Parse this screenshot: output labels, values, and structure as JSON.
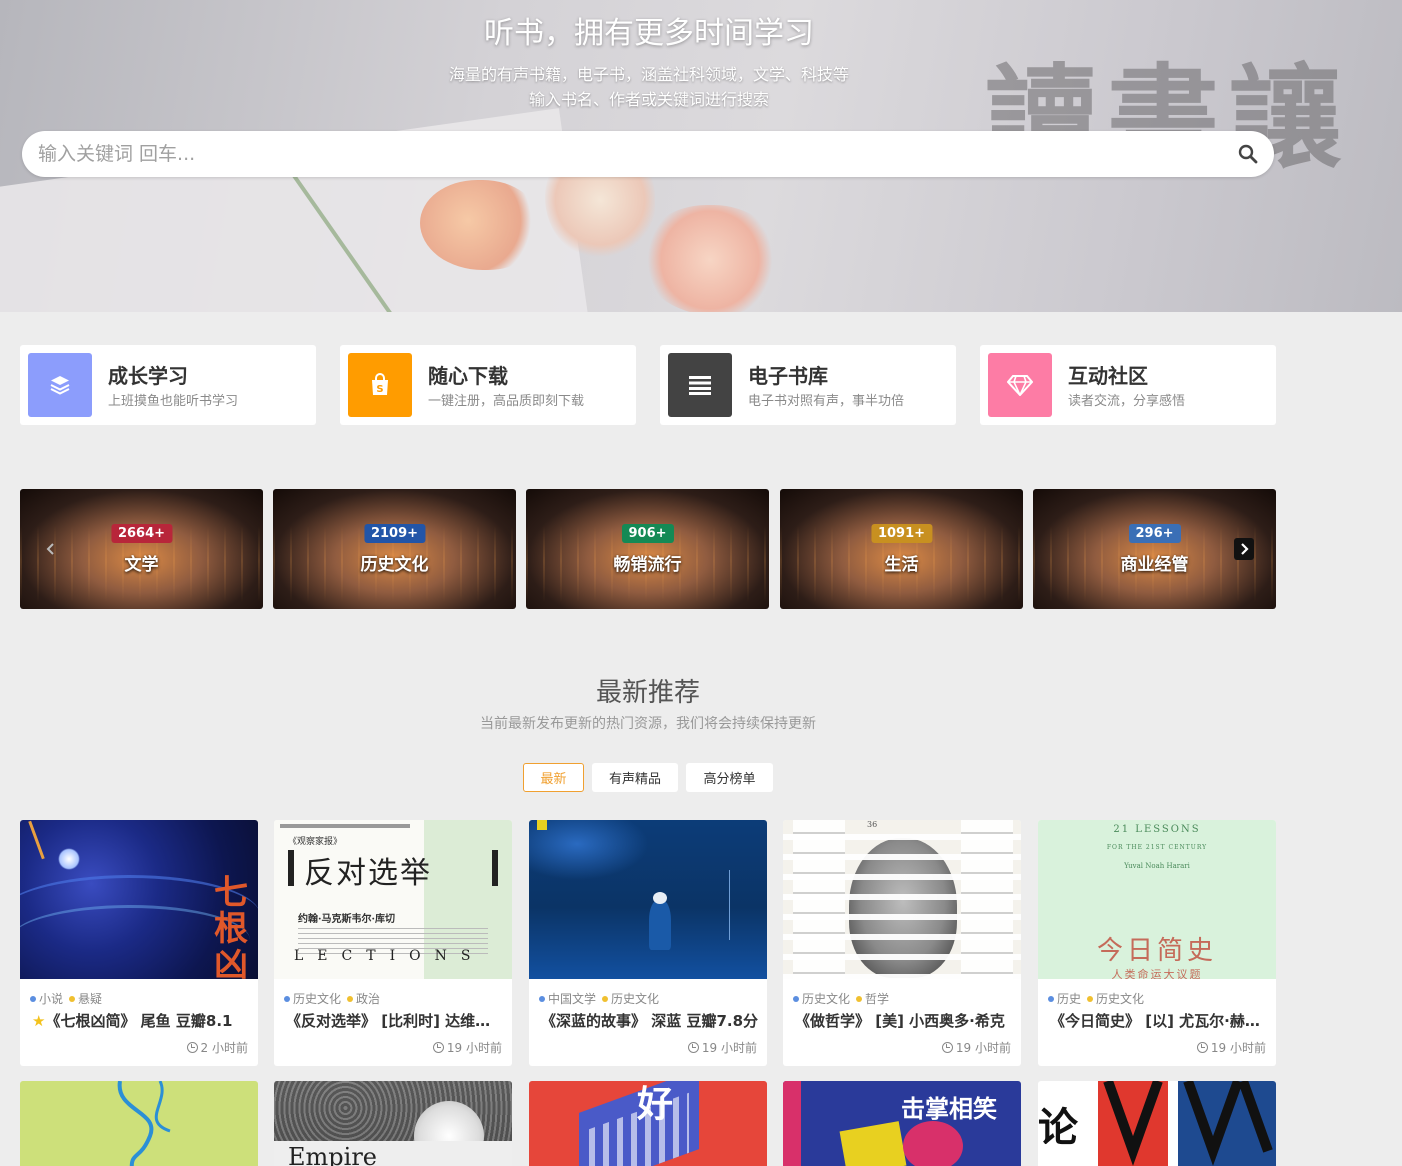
{
  "hero": {
    "title": "听书，拥有更多时间学习",
    "subtitle_line1": "海量的有声书籍，电子书，涵盖社科领域，文学、科技等",
    "subtitle_line2": "输入书名、作者或关键词进行搜索",
    "background_text": "讀書讓",
    "search": {
      "placeholder": "输入关键词 回车...",
      "value": "",
      "icon": "search-icon"
    }
  },
  "features": [
    {
      "title": "成长学习",
      "desc": "上班摸鱼也能听书学习",
      "icon": "layers-icon",
      "color": "#8c9dfc"
    },
    {
      "title": "随心下载",
      "desc": "一键注册，高品质即刻下载",
      "icon": "shopping-bag-icon",
      "color": "#ff9c00"
    },
    {
      "title": "电子书库",
      "desc": "电子书对照有声，事半功倍",
      "icon": "list-icon",
      "color": "#434343"
    },
    {
      "title": "互动社区",
      "desc": "读者交流，分享感悟",
      "icon": "diamond-icon",
      "color": "#fd7ca5"
    }
  ],
  "categories": [
    {
      "name": "文学",
      "count": "2664+",
      "badge_color": "#b8263a"
    },
    {
      "name": "历史文化",
      "count": "2109+",
      "badge_color": "#2255a8"
    },
    {
      "name": "畅销流行",
      "count": "906+",
      "badge_color": "#148a55"
    },
    {
      "name": "生活",
      "count": "1091+",
      "badge_color": "#c89020"
    },
    {
      "name": "商业经管",
      "count": "296+",
      "badge_color": "#3a6fb6"
    }
  ],
  "carousel": {
    "prev_icon": "chevron-left-icon",
    "next_icon": "chevron-right-icon"
  },
  "section": {
    "title": "最新推荐",
    "subtitle": "当前最新发布更新的热门资源，我们将会持续保持更新",
    "tabs": [
      "最新",
      "有声精品",
      "高分榜单"
    ],
    "active_tab": "最新"
  },
  "books": [
    {
      "tag1": "小说",
      "tag2": "悬疑",
      "title": "《七根凶简》 尾鱼 豆瓣8.1",
      "time": "2 小时前",
      "starred": true
    },
    {
      "tag1": "历史文化",
      "tag2": "政治",
      "title": "《反对选举》 [比利时] 达维德·范雷布鲁克",
      "time": "19 小时前",
      "starred": false
    },
    {
      "tag1": "中国文学",
      "tag2": "历史文化",
      "title": "《深蓝的故事》 深蓝 豆瓣7.8分",
      "time": "19 小时前",
      "starred": false
    },
    {
      "tag1": "历史文化",
      "tag2": "哲学",
      "title": "《做哲学》 [美] 小西奥多·希克",
      "time": "19 小时前",
      "starred": false
    },
    {
      "tag1": "历史",
      "tag2": "历史文化",
      "title": "《今日简史》 [以] 尤瓦尔·赫拉利",
      "time": "19 小时前",
      "starred": false
    }
  ],
  "covers": {
    "b1_text": "七根凶简",
    "b2_head": "《观察家报》",
    "b2_title": "反对选举",
    "b2_author": "约翰·马克斯韦尔·库切",
    "b2_bottom": "LECTIONS",
    "b4_num": "36",
    "b5_en": "21 LESSONS",
    "b5_sub": "FOR THE 21ST CENTURY",
    "b5_author": "Yuval Noah Harari",
    "b5_cn": "今日简史",
    "b5_cn2": "人类命运大议题",
    "r2_b2": "Empire",
    "r2_b3": "好",
    "r2_b4": "击掌相笑",
    "r2_b5": "论"
  },
  "colors": {
    "tag_blue": "#5b8ee0",
    "tag_yellow": "#f0c030",
    "accent": "#f0a030"
  }
}
